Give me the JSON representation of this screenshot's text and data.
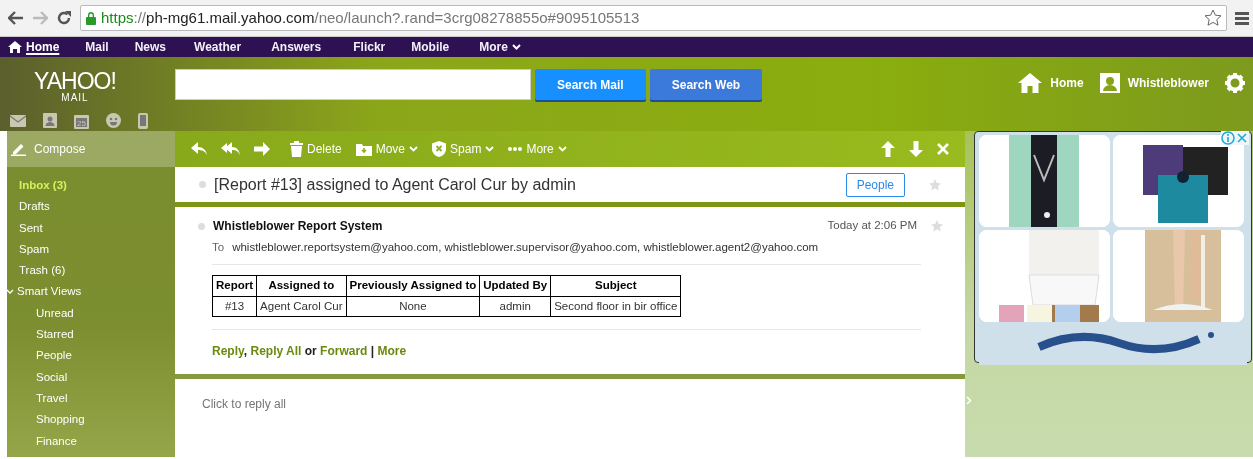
{
  "browser": {
    "scheme": "https",
    "separator": "://",
    "host": "ph-mg61.mail.yahoo.com",
    "path": "/neo/launch?.rand=3crg08278855o#9095105513"
  },
  "top_nav": [
    {
      "label": "Home",
      "selected": true,
      "kind": "home"
    },
    {
      "label": "Mail",
      "selected": false
    },
    {
      "label": "News",
      "selected": false
    },
    {
      "label": "Weather",
      "selected": false
    },
    {
      "label": "Answers",
      "selected": false
    },
    {
      "label": "Flickr",
      "selected": false
    },
    {
      "label": "Mobile",
      "selected": false
    },
    {
      "label": "More",
      "selected": false,
      "kind": "menu"
    }
  ],
  "header": {
    "logo": "YAHOO!",
    "logo_sub": "MAIL",
    "app_icons": [
      {
        "kind": "mail"
      },
      {
        "kind": "contacts"
      },
      {
        "kind": "calendar",
        "label": "25"
      },
      {
        "kind": "messenger"
      },
      {
        "kind": "mobile"
      }
    ],
    "search_buttons": [
      {
        "label": "Search Mail",
        "kind": "mail"
      },
      {
        "label": "Search Web",
        "kind": "web"
      }
    ],
    "home_link": "Home",
    "user_name": "Whistleblower"
  },
  "sidebar": {
    "compose": "Compose",
    "folders": [
      {
        "label": "Inbox (3)",
        "selected": true
      },
      {
        "label": "Drafts",
        "selected": false
      },
      {
        "label": "Sent",
        "selected": false
      },
      {
        "label": "Spam",
        "selected": false
      },
      {
        "label": "Trash (6)",
        "selected": false
      },
      {
        "label": "Smart Views",
        "selected": false,
        "expanded": true,
        "children": [
          {
            "label": "Unread",
            "selected": false
          },
          {
            "label": "Starred",
            "selected": false
          },
          {
            "label": "People",
            "selected": false
          },
          {
            "label": "Social",
            "selected": false
          },
          {
            "label": "Travel",
            "selected": false
          },
          {
            "label": "Shopping",
            "selected": false
          },
          {
            "label": "Finance",
            "selected": false
          }
        ]
      }
    ]
  },
  "toolbar": {
    "actions": [
      {
        "kind": "reply"
      },
      {
        "kind": "reply-all"
      },
      {
        "kind": "forward"
      },
      {
        "kind": "delete",
        "label": "Delete"
      },
      {
        "kind": "move",
        "label": "Move"
      },
      {
        "kind": "spam",
        "label": "Spam"
      },
      {
        "kind": "more",
        "label": "More"
      }
    ]
  },
  "message": {
    "subject": "[Report #13] assigned to Agent Carol Cur by admin",
    "people_button": "People",
    "starred": false,
    "sender": "Whistleblower Report System",
    "date": "Today at 2:06 PM",
    "to_label": "To",
    "recipients": "whistleblower.reportsystem@yahoo.com, whistleblower.supervisor@yahoo.com, whistleblower.agent2@yahoo.com",
    "table": {
      "columns": [
        "Report",
        "Assigned to",
        "Previously Assigned to",
        "Updated By",
        "Subject"
      ],
      "rows": [
        [
          "#13",
          "Agent Carol Cur",
          "None",
          "admin",
          "Second floor in bir office"
        ]
      ]
    },
    "reply_links": [
      {
        "label": "Reply",
        "kind": "link"
      },
      {
        "label": ", ",
        "kind": "text"
      },
      {
        "label": "Reply All",
        "kind": "link"
      },
      {
        "label": " or ",
        "kind": "text"
      },
      {
        "label": "Forward",
        "kind": "link"
      },
      {
        "label": " | ",
        "kind": "text"
      },
      {
        "label": "More",
        "kind": "link"
      }
    ],
    "reply_placeholder": "Click to reply all"
  }
}
